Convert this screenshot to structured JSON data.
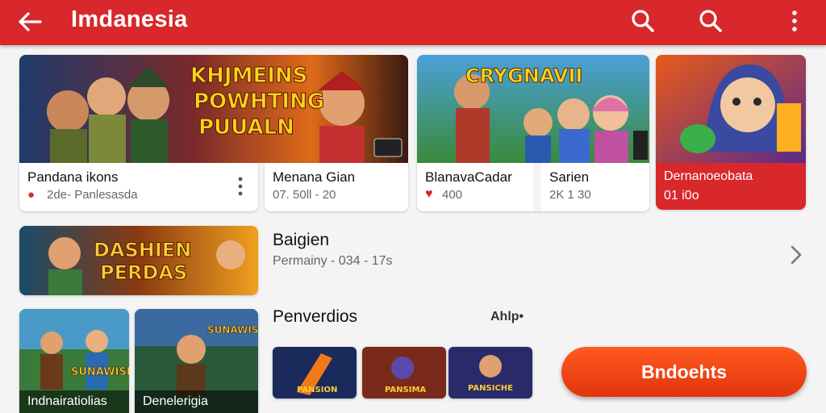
{
  "header": {
    "title": "Imdanesia",
    "icons": [
      "back-arrow-icon",
      "search-icon",
      "search-icon",
      "more-vertical-icon"
    ]
  },
  "banners": [
    {
      "art_lines": [
        "KHJMEINS",
        "POWHTING",
        "PUUALN"
      ],
      "title": "Pandana ikons",
      "sub_icon": "game-icon",
      "subtitle": "2de- Panlesasda"
    },
    {
      "title": "Menana Gian",
      "subtitle": "07. 50ll - 20"
    },
    {
      "art_lines": [
        "CRYGNAVII"
      ],
      "title": "BlanavaCadar",
      "sub_icon": "heart-icon",
      "subtitle": "400"
    },
    {
      "title": "Sarien",
      "subtitle": "2K 1 30"
    },
    {
      "title": "Dernanoeobata",
      "subtitle": "01 i0o"
    }
  ],
  "featured": {
    "art_lines": [
      "DASHIEN",
      "PERDAS"
    ],
    "title": "Baigien",
    "subtitle": "Permainy - 034 - 17s",
    "chevron": "chevron-right-icon"
  },
  "tiles": [
    {
      "art": "SUNAWISH",
      "caption": "Indnairatiolias"
    },
    {
      "art": "SUNAWISH",
      "caption": "Denelerigia"
    }
  ],
  "section": {
    "title": "Penverdios",
    "more": "Ahlp•",
    "thumbs": [
      {
        "art": "PANSION"
      },
      {
        "art": "PANSIMA"
      },
      {
        "art": "PANSICHE"
      }
    ]
  },
  "cta": {
    "label": "Bndoehts"
  },
  "colors": {
    "brand_red": "#d8282b",
    "cta_orange": "#f0481a"
  }
}
